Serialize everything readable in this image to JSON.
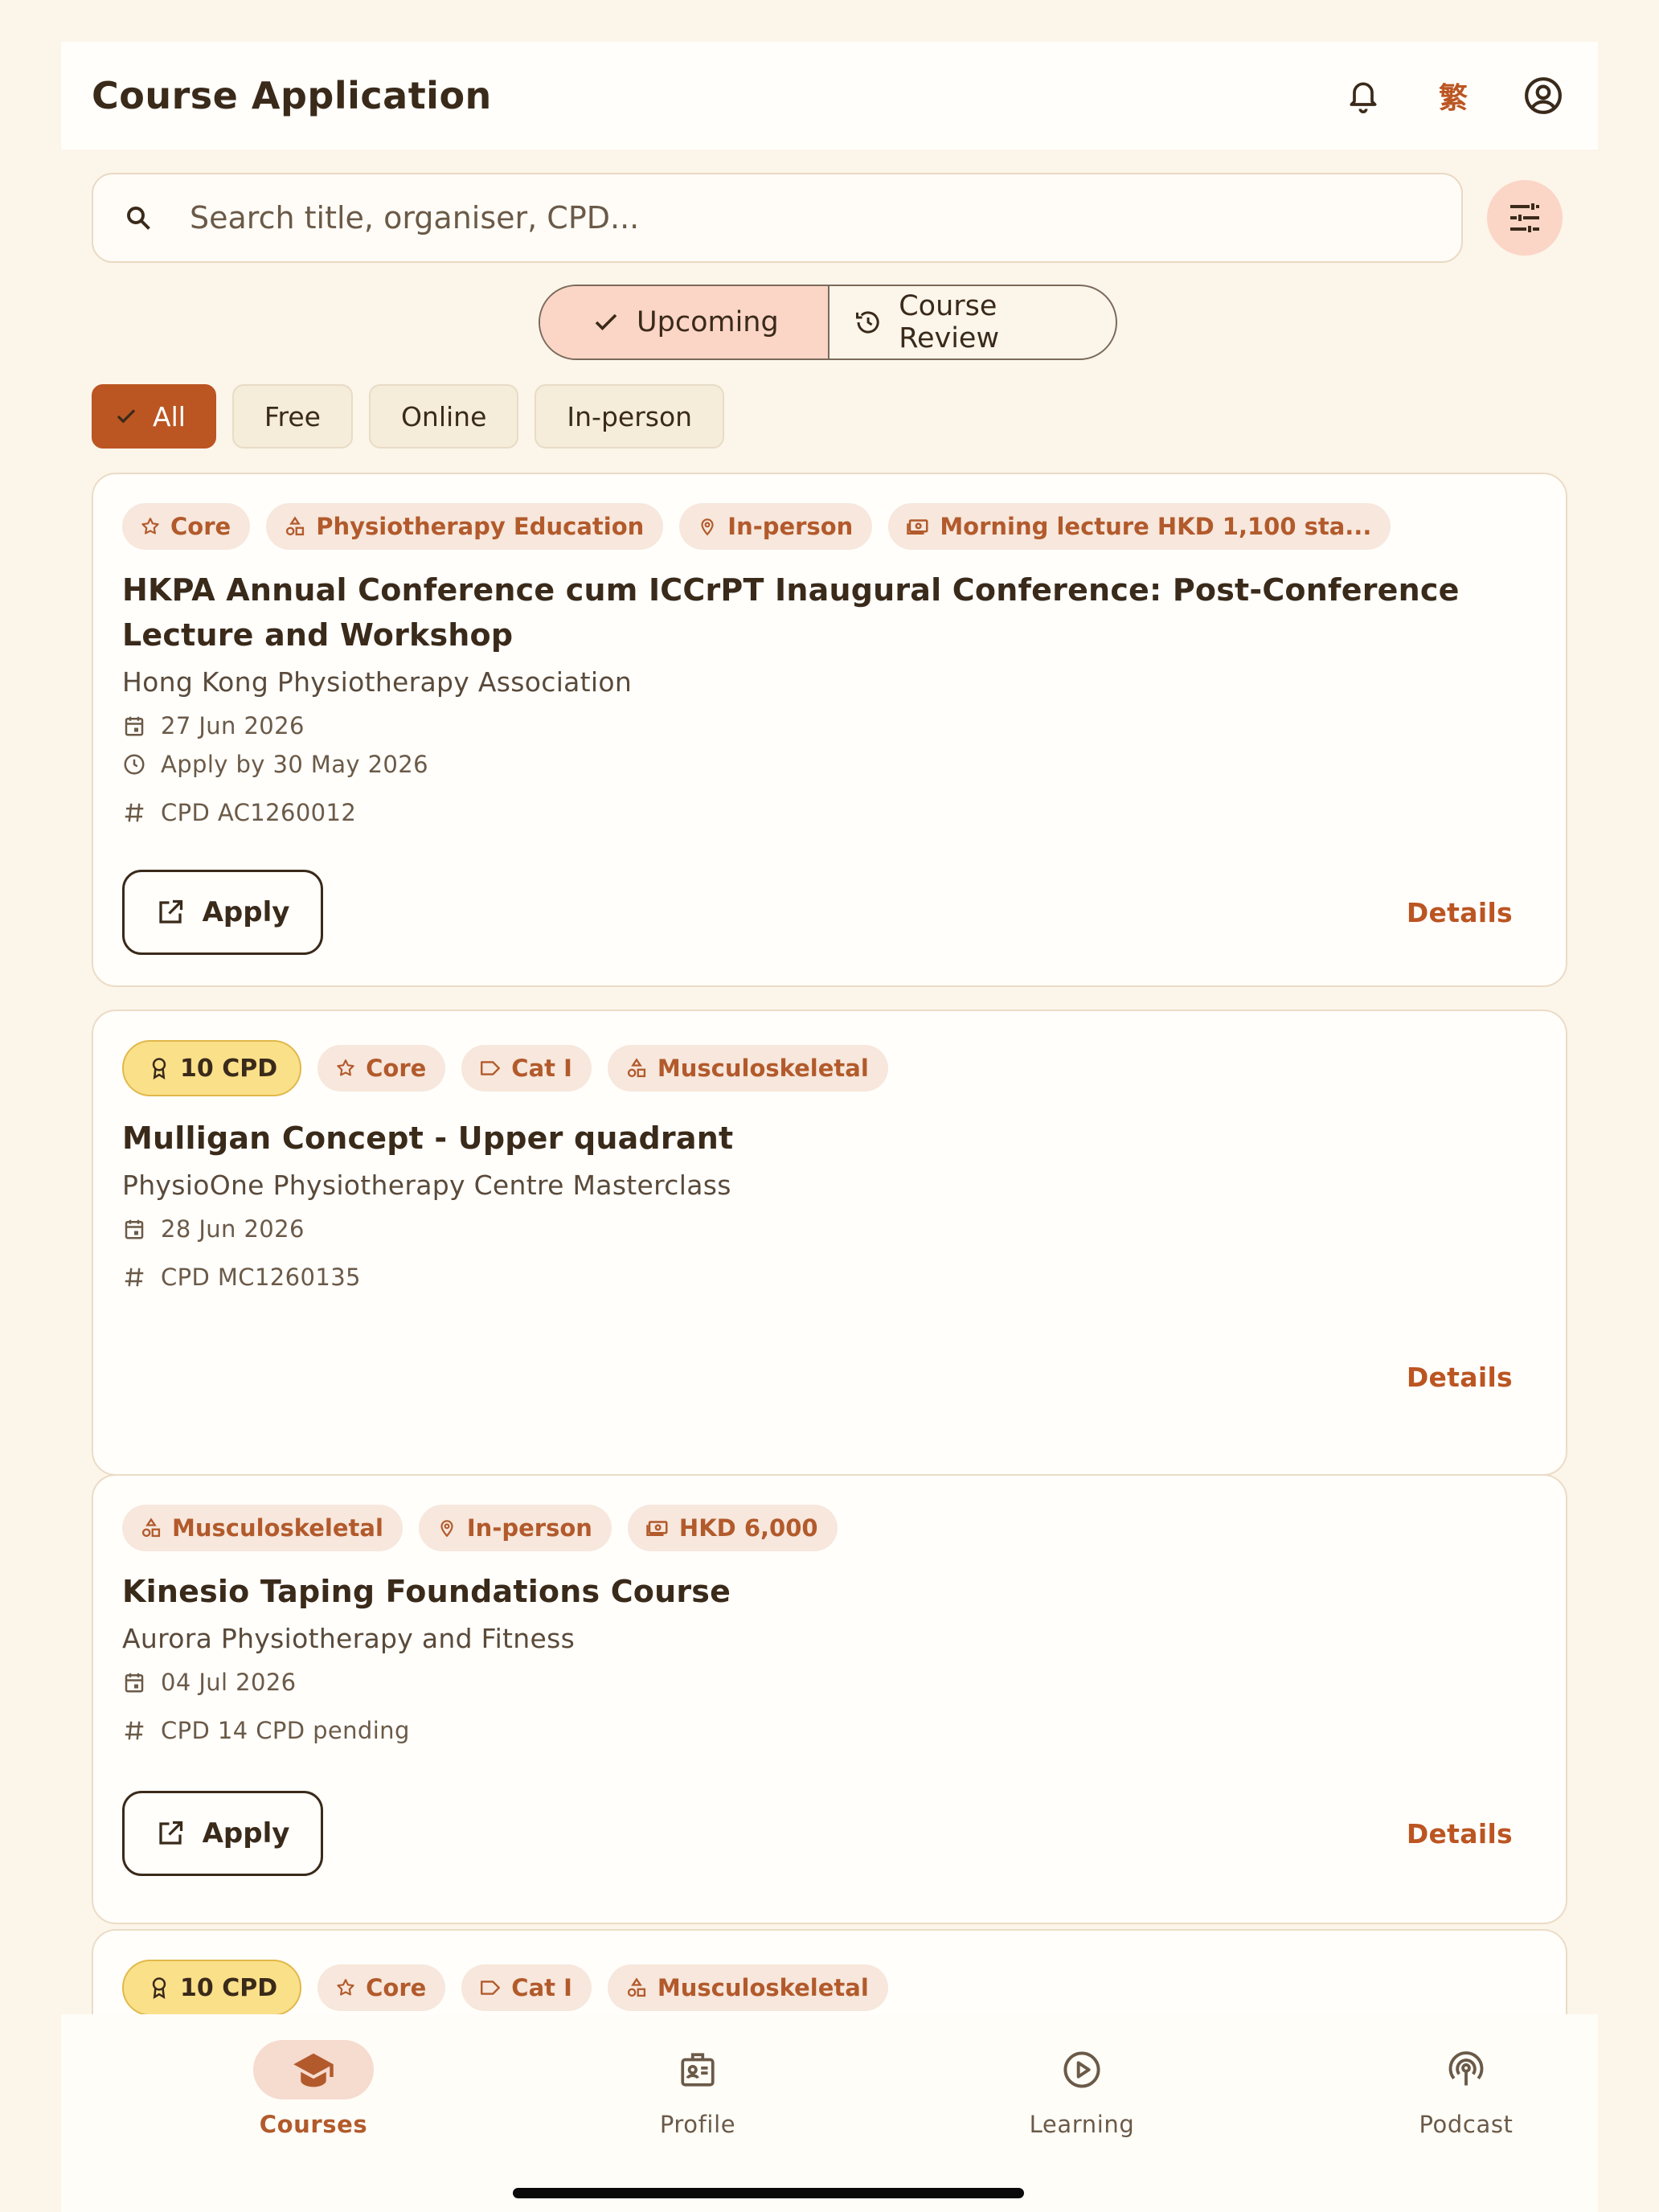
{
  "appbar": {
    "title": "Course Application",
    "lang_label": "繁"
  },
  "search": {
    "placeholder": "Search title, organiser, CPD..."
  },
  "segments": {
    "upcoming": "Upcoming",
    "review": "Course Review"
  },
  "chips": [
    "All",
    "Free",
    "Online",
    "In-person"
  ],
  "cards": [
    {
      "tags": [
        "Core",
        "Physiotherapy Education",
        "In-person",
        "Morning lecture HKD 1,100 sta..."
      ],
      "title": "HKPA Annual Conference cum ICCrPT Inaugural Conference: Post-Conference Lecture and Workshop",
      "organiser": "Hong Kong Physiotherapy Association",
      "date": "27 Jun 2026",
      "deadline": "Apply by 30 May 2026",
      "cpd": "CPD AC1260012",
      "apply_label": "Apply",
      "details_label": "Details"
    },
    {
      "cpd_badge": "10 CPD",
      "tags": [
        "Core",
        "Cat I",
        "Musculoskeletal"
      ],
      "title": "Mulligan Concept - Upper quadrant",
      "organiser": "PhysioOne Physiotherapy Centre Masterclass",
      "date": "28 Jun 2026",
      "cpd": "CPD MC1260135",
      "details_label": "Details"
    },
    {
      "tags": [
        "Musculoskeletal",
        "In-person",
        "HKD 6,000"
      ],
      "title": "Kinesio Taping Foundations Course",
      "organiser": "Aurora Physiotherapy and Fitness",
      "date": "04 Jul 2026",
      "cpd": "CPD 14 CPD pending",
      "apply_label": "Apply",
      "details_label": "Details"
    },
    {
      "cpd_badge": "10 CPD",
      "tags": [
        "Core",
        "Cat I",
        "Musculoskeletal"
      ]
    }
  ],
  "nav": [
    "Courses",
    "Profile",
    "Learning",
    "Podcast"
  ],
  "colors": {
    "accent": "#bb5522",
    "background": "#fcf5ea",
    "tag_bg": "#f7e7dc",
    "cpd_badge": "#fbe08a"
  }
}
